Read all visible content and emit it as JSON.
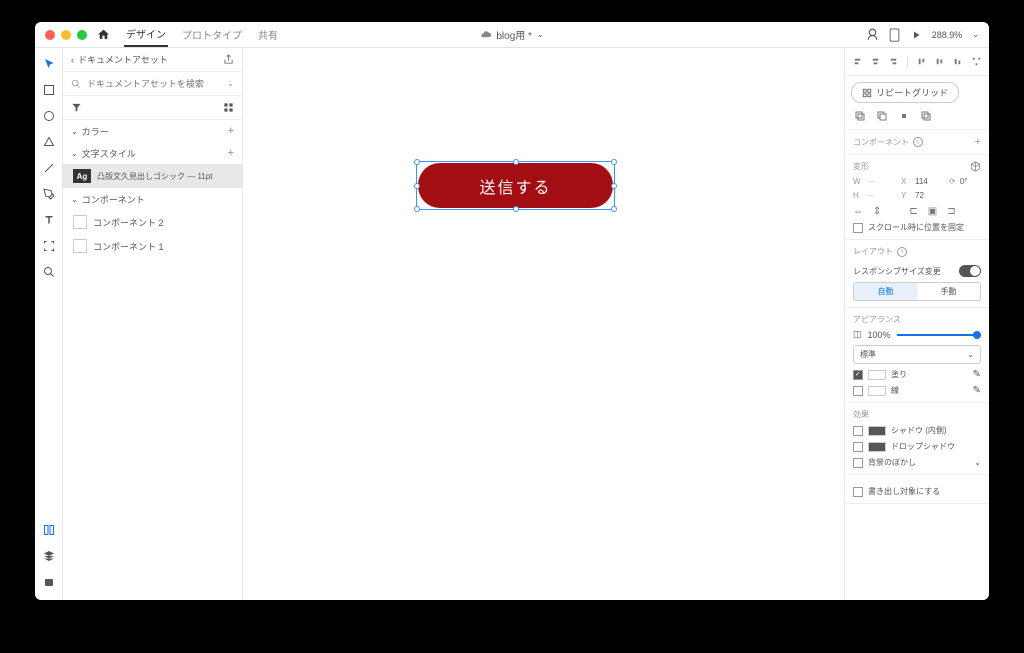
{
  "titlebar": {
    "tabs": [
      "デザイン",
      "プロトタイプ",
      "共有"
    ],
    "document": "blog用 *",
    "zoom": "288.9%"
  },
  "assets": {
    "header": "ドキュメントアセット",
    "searchPlaceholder": "ドキュメントアセットを検索",
    "sections": {
      "color": "カラー",
      "charStyle": "文字スタイル",
      "component": "コンポーネント"
    },
    "charStyleItem": "凸版文久見出しゴシック — 11pt",
    "components": [
      "コンポーネント 2",
      "コンポーネント 1"
    ]
  },
  "canvas": {
    "buttonText": "送信する"
  },
  "inspector": {
    "repeatGrid": "リピートグリッド",
    "componentTitle": "コンポーネント",
    "transform": {
      "title": "変形",
      "w": "",
      "h": "",
      "x": "114",
      "y": "72",
      "rotation": "0°"
    },
    "fixScroll": "スクロール時に位置を固定",
    "layoutTitle": "レイアウト",
    "responsive": "レスポンシブサイズ変更",
    "segAuto": "自動",
    "segManual": "手動",
    "appearanceTitle": "アピアランス",
    "opacity": "100%",
    "blendMode": "標準",
    "fill": "塗り",
    "stroke": "線",
    "effectsTitle": "効果",
    "innerShadow": "シャドウ (内側)",
    "dropShadow": "ドロップシャドウ",
    "blur": "背景のぼかし",
    "exportMark": "書き出し対象にする"
  }
}
